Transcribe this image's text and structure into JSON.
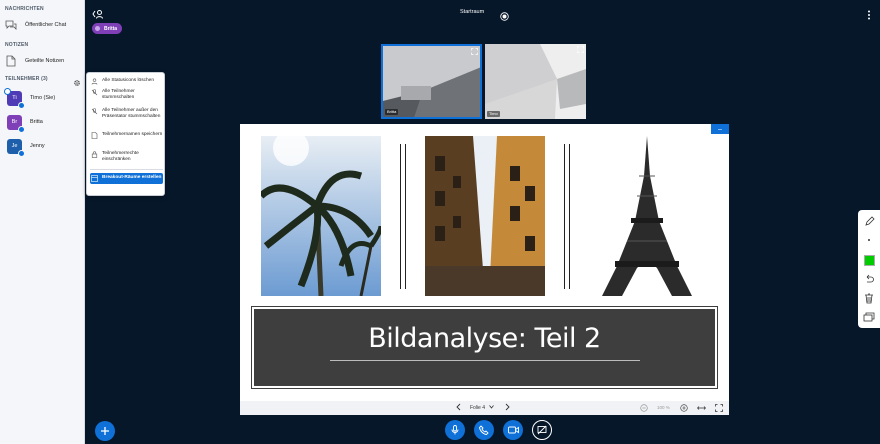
{
  "sidebar": {
    "messages_title": "NACHRICHTEN",
    "public_chat": "Öffentlicher Chat",
    "notes_title": "NOTIZEN",
    "shared_notes": "Geteilte Notizen",
    "participants_title": "TEILNEHMER (3)",
    "users": [
      {
        "initials": "Ti",
        "name": "Timo (Sie)",
        "color": "#4f3bb5"
      },
      {
        "initials": "Br",
        "name": "Britta",
        "color": "#7f3fb7"
      },
      {
        "initials": "Je",
        "name": "Jenny",
        "color": "#1d5fab"
      }
    ]
  },
  "menu": {
    "items": [
      "Alle Statusicons löschen",
      "Alle Teilnehmer stummschalten",
      "Alle Teilnehmer außer den Präsentator stummschalten",
      "Teilnehmernamen speichern",
      "Teilnehmerrechte einschränken"
    ],
    "breakout": "Breakout-Räume erstellen"
  },
  "topbar": {
    "title": "Startraum"
  },
  "presenter": {
    "name": "Britta"
  },
  "webcams": [
    {
      "name": "Britta"
    },
    {
      "name": "Timo"
    }
  ],
  "slide": {
    "title": "Bildanalyse: Teil 2",
    "page_label": "Folie 4",
    "zoom": "100 %"
  },
  "colors": {
    "accent": "#0f70d7",
    "background": "#06172a",
    "pen_color": "#00cc00"
  }
}
